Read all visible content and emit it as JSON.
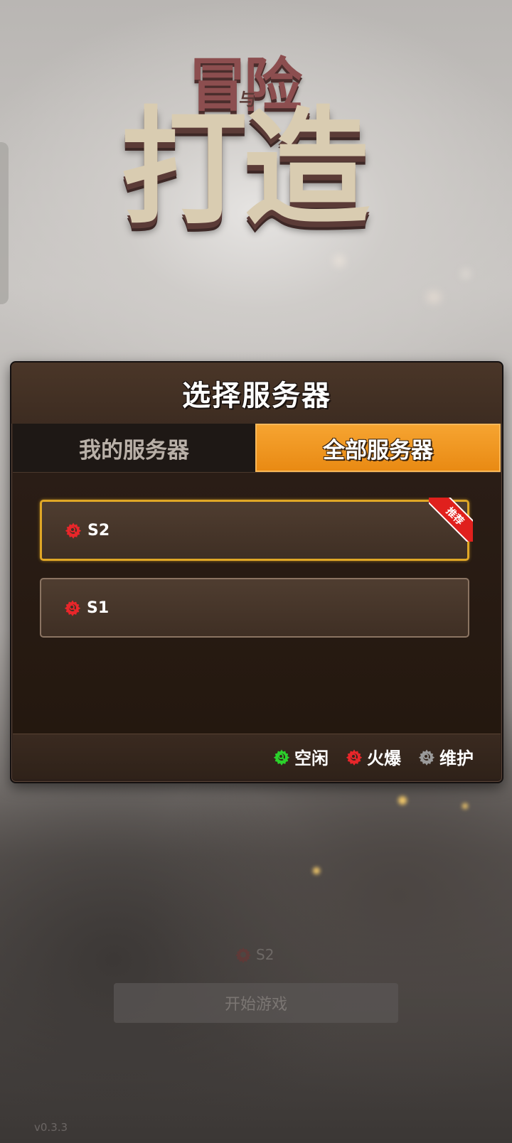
{
  "logo": {
    "top": "冒险",
    "mid": "与",
    "main": "打造"
  },
  "dialog": {
    "title": "选择服务器",
    "tabs": [
      {
        "label": "我的服务器",
        "active": false
      },
      {
        "label": "全部服务器",
        "active": true
      }
    ],
    "servers": [
      {
        "name": "S2",
        "status": "hot",
        "badge": "推荐",
        "selected": true
      },
      {
        "name": "S1",
        "status": "hot",
        "selected": false
      }
    ],
    "legend": [
      {
        "label": "空闲",
        "color": "#2bd12b",
        "icon": "gear-idle-icon"
      },
      {
        "label": "火爆",
        "color": "#e8262a",
        "icon": "gear-hot-icon"
      },
      {
        "label": "维护",
        "color": "#9a9a9a",
        "icon": "gear-maintenance-icon"
      }
    ]
  },
  "background": {
    "current_server": "S2",
    "start_button": "开始游戏",
    "version": "v0.3.3"
  },
  "colors": {
    "accent_orange": "#e98a13",
    "selected_border": "#e0a726",
    "status_hot": "#e8262a",
    "status_idle": "#2bd12b",
    "status_maintenance": "#9a9a9a"
  }
}
